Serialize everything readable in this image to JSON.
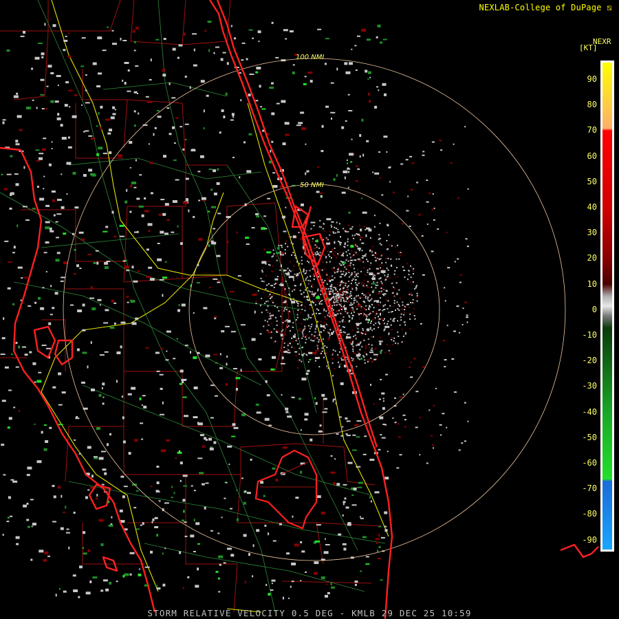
{
  "header": {
    "credit": "NEXLAB-College of DuPage"
  },
  "legend": {
    "title": "NEXR",
    "unit": "[KT]",
    "ticks": [
      "90",
      "80",
      "70",
      "60",
      "50",
      "40",
      "30",
      "20",
      "10",
      "0",
      "-10",
      "-20",
      "-30",
      "-40",
      "-50",
      "-60",
      "-70",
      "-80",
      "-90"
    ],
    "colors": {
      "yellow": "#ffff00",
      "orange": "#ffae6b",
      "red": "#ff0000",
      "darkred": "#5a0000",
      "gray": "#c8c8c8",
      "darkgreen": "#0b4a0b",
      "green": "#22e02a",
      "blue": "#1c6bd8",
      "lightblue": "#1aa6ff"
    }
  },
  "range_rings": {
    "outer": "100 NMI",
    "inner": "50 NMI"
  },
  "caption": "STORM RELATIVE VELOCITY 0.5 DEG - KMLB 29 DEC 25 10:59",
  "colors": {
    "background": "#000000",
    "county_lines": "#a01010",
    "coast": "#ff2020",
    "highways": "#e6e600",
    "roads": "#2e8b3a",
    "rings": "#f0c8a0"
  }
}
